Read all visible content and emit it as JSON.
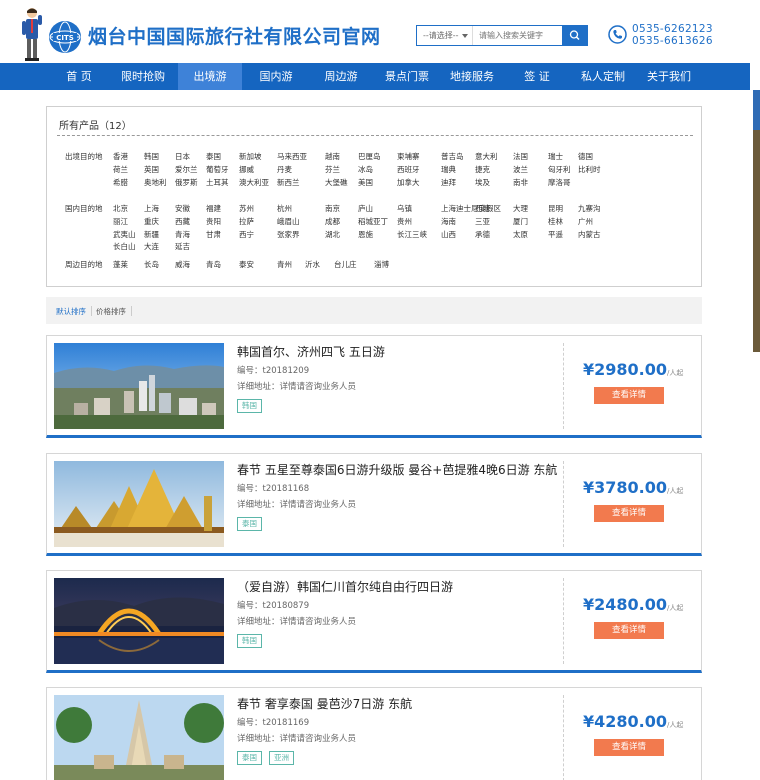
{
  "header": {
    "logo_text": "CITS",
    "title": "烟台中国国际旅行社有限公司官网",
    "search": {
      "select_value": "--请选择--",
      "placeholder": "请输入搜索关键字"
    },
    "phones": [
      "0535-6262123",
      "0535-6613626"
    ]
  },
  "nav": {
    "items": [
      {
        "label": "首 页",
        "active": false
      },
      {
        "label": "限时抢购",
        "active": false
      },
      {
        "label": "出境游",
        "active": true
      },
      {
        "label": "国内游",
        "active": false
      },
      {
        "label": "周边游",
        "active": false
      },
      {
        "label": "景点门票",
        "active": false
      },
      {
        "label": "地接服务",
        "active": false
      },
      {
        "label": "签 证",
        "active": false
      },
      {
        "label": "私人定制",
        "active": false
      },
      {
        "label": "关于我们",
        "active": false
      }
    ]
  },
  "filter": {
    "title": "所有产品（12）",
    "groups": [
      {
        "label": "出境目的地",
        "rows": [
          [
            "香港",
            "韩国",
            "日本",
            "泰国",
            "新加坡",
            "马来西亚",
            "越南",
            "巴厘岛",
            "柬埔寨",
            "普吉岛",
            "意大利",
            "法国",
            "瑞士",
            "德国"
          ],
          [
            "荷兰",
            "英国",
            "爱尔兰",
            "葡萄牙",
            "挪威",
            "丹麦",
            "芬兰",
            "冰岛",
            "西班牙",
            "瑞典",
            "捷克",
            "波兰",
            "匈牙利",
            "比利时"
          ],
          [
            "希腊",
            "奥地利",
            "俄罗斯",
            "土耳其",
            "澳大利亚",
            "新西兰",
            "大堡礁",
            "美国",
            "加拿大",
            "迪拜",
            "埃及",
            "南非",
            "摩洛哥"
          ]
        ]
      },
      {
        "label": "国内目的地",
        "rows": [
          [
            "北京",
            "上海",
            "安徽",
            "福建",
            "苏州",
            "杭州",
            "南京",
            "庐山",
            "乌镇",
            "上海迪士尼度假区",
            "西塘",
            "大理",
            "昆明",
            "九寨沟"
          ],
          [
            "丽江",
            "重庆",
            "西藏",
            "贵阳",
            "拉萨",
            "峨眉山",
            "成都",
            "稻城亚丁",
            "贵州",
            "海南",
            "三亚",
            "厦门",
            "桂林",
            "广州"
          ],
          [
            "武夷山",
            "新疆",
            "青海",
            "甘肃",
            "西宁",
            "张家界",
            "湖北",
            "恩施",
            "长江三峡",
            "山西",
            "承德",
            "太原",
            "平遥",
            "内蒙古"
          ],
          [
            "长白山",
            "大连",
            "延吉"
          ]
        ]
      },
      {
        "label": "周边目的地",
        "rows": [
          [
            "蓬莱",
            "长岛",
            "威海",
            "青岛",
            "泰安",
            "青州",
            "沂水",
            "台儿庄",
            "淄博"
          ]
        ]
      }
    ]
  },
  "sort": {
    "items": [
      {
        "label": "默认排序",
        "active": true
      },
      {
        "label": "价格排序",
        "active": false
      }
    ]
  },
  "products": [
    {
      "title": "韩国首尔、济州四飞 五日游",
      "code": "编号：t20181209",
      "address": "详细地址：详情请咨询业务人员",
      "tags": [
        "韩国"
      ],
      "price": "¥2980.00",
      "unit": "/人起",
      "button": "查看详情",
      "image": "city"
    },
    {
      "title": "春节 五星至尊泰国6日游升级版 曼谷+芭提雅4晚6日游 东航",
      "code": "编号：t20181168",
      "address": "详细地址：详情请咨询业务人员",
      "tags": [
        "泰国"
      ],
      "price": "¥3780.00",
      "unit": "/人起",
      "button": "查看详情",
      "image": "temple"
    },
    {
      "title": "（爱自游）韩国仁川首尔纯自由行四日游",
      "code": "编号：t20180879",
      "address": "详细地址：详情请咨询业务人员",
      "tags": [
        "韩国"
      ],
      "price": "¥2480.00",
      "unit": "/人起",
      "button": "查看详情",
      "image": "bridge"
    },
    {
      "title": "春节 奢享泰国 曼芭沙7日游 东航",
      "code": "编号：t20181169",
      "address": "详细地址：详情请咨询业务人员",
      "tags": [
        "泰国",
        "亚洲"
      ],
      "price": "¥4280.00",
      "unit": "/人起",
      "button": "查看详情",
      "image": "wat"
    }
  ],
  "colors": {
    "brand_blue": "#1565c0",
    "nav_active": "#3e82d8",
    "price_blue": "#1f6fc7",
    "button_orange": "#f27a4e",
    "tag_green": "#5bb6a9"
  },
  "icons": {
    "search": "search-icon",
    "phone": "phone-icon",
    "logo": "cits-globe-logo",
    "mascot": "mascot-figure"
  }
}
